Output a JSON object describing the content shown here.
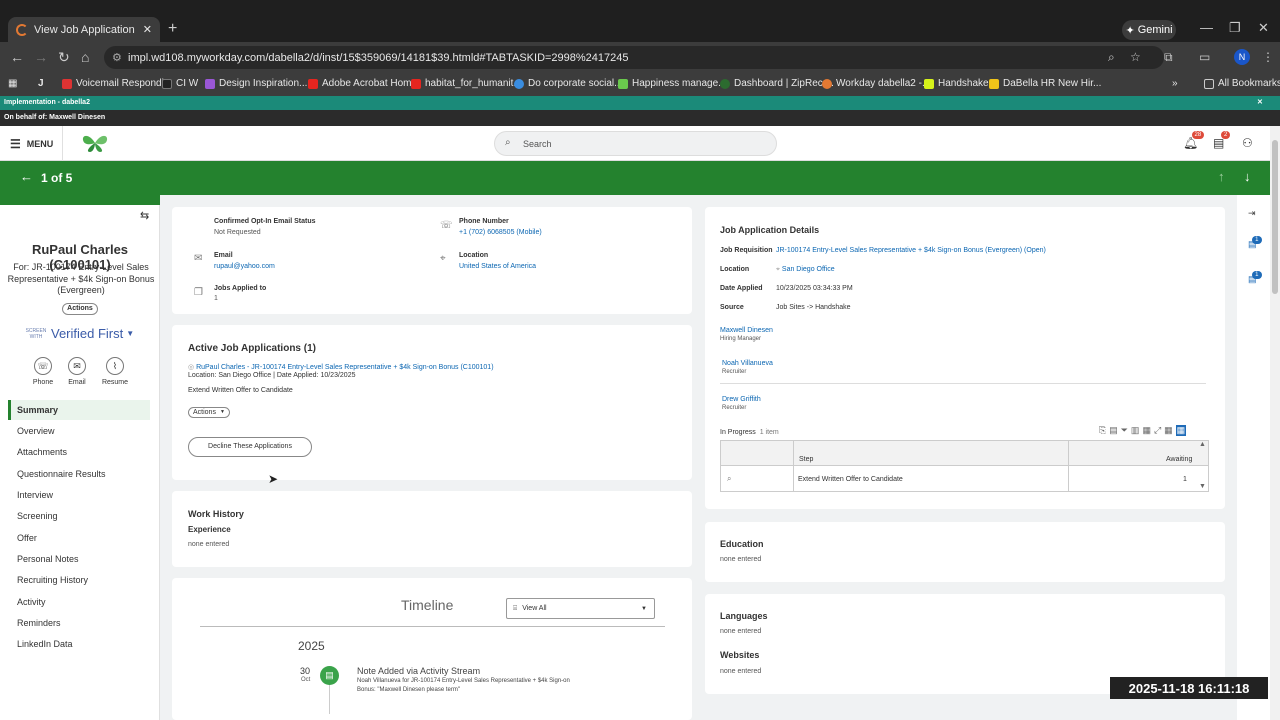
{
  "browser": {
    "tab_title": "View Job Application - RuPaul C",
    "url": "impl.wd108.myworkday.com/dabella2/d/inst/15$359069/14181$39.htmld#TABTASKID=2998%2417245",
    "gemini_label": "Gemini",
    "profile_initial": "N",
    "bookmarks": [
      "Voicemail Respondi...",
      "CI W",
      "Design Inspiration...",
      "Adobe Acrobat Home",
      "habitat_for_humanit...",
      "Do corporate social...",
      "Happiness manage...",
      "Dashboard | ZipRecr...",
      "Workday dabella2 -...",
      "Handshake",
      "DaBella HR New Hir..."
    ],
    "all_bookmarks": "All Bookmarks"
  },
  "impl": {
    "banner": "Implementation - dabella2",
    "behalf": "On behalf of: Maxwell Dinesen"
  },
  "header": {
    "menu_label": "MENU",
    "search_placeholder": "Search",
    "notif_count": "28",
    "inbox_count": "2"
  },
  "pager": "1 of 5",
  "candidate": {
    "name": "RuPaul Charles (C100101)",
    "for": "For: JR-100174 Entry-Level Sales Representative + $4k Sign-on Bonus (Evergreen)",
    "actions_label": "Actions",
    "vf_screen": "SCREEN WITH",
    "vf_brand": "Verified First",
    "quick": [
      "Phone",
      "Email",
      "Resume"
    ]
  },
  "nav": [
    "Summary",
    "Overview",
    "Attachments",
    "Questionnaire Results",
    "Interview",
    "Screening",
    "Offer",
    "Personal Notes",
    "Recruiting History",
    "Activity",
    "Reminders",
    "LinkedIn Data"
  ],
  "contact": {
    "optin_label": "Confirmed Opt-In Email Status",
    "optin_value": "Not Requested",
    "phone_label": "Phone Number",
    "phone_value": "+1 (702) 6068505 (Mobile)",
    "email_label": "Email",
    "email_value": "rupaul@yahoo.com",
    "location_label": "Location",
    "location_value": "United States of America",
    "jobs_label": "Jobs Applied to",
    "jobs_value": "1"
  },
  "active": {
    "title": "Active Job Applications (1)",
    "app_link": "RuPaul Charles - JR-100174 Entry-Level Sales Representative + $4k Sign-on Bonus (C100101)",
    "app_meta": "Location: San Diego Office | Date Applied: 10/23/2025",
    "step": "Extend Written Offer to Candidate",
    "actions": "Actions",
    "decline": "Decline These Applications"
  },
  "work": {
    "title": "Work History",
    "sub": "Experience",
    "value": "none entered"
  },
  "timeline": {
    "title": "Timeline",
    "filter": "View All",
    "year": "2025",
    "day": "30",
    "month": "Oct",
    "event_title": "Note Added via Activity Stream",
    "event_desc": "Noah Villanueva for JR-100174 Entry-Level Sales Representative + $4k Sign-on Bonus: \"Maxwell Dinesen please term\""
  },
  "details": {
    "title": "Job Application Details",
    "req_label": "Job Requisition",
    "req_value": "JR-100174 Entry-Level Sales Representative + $4k Sign-on Bonus (Evergreen) (Open)",
    "loc_label": "Location",
    "loc_value": "San Diego Office",
    "date_label": "Date Applied",
    "date_value": "10/23/2025 03:34:33 PM",
    "source_label": "Source",
    "source_value": "Job Sites -> Handshake",
    "people": [
      {
        "name": "Maxwell Dinesen",
        "role": "Hiring Manager"
      },
      {
        "name": "Noah Villanueva",
        "role": "Recruiter"
      },
      {
        "name": "Drew Griffith",
        "role": "Recruiter"
      }
    ],
    "inprogress": "In Progress",
    "items": "1 item",
    "col_step": "Step",
    "col_awaiting": "Awaiting",
    "row_step": "Extend Written Offer to Candidate",
    "row_awaiting": "1"
  },
  "education": {
    "title": "Education",
    "value": "none entered"
  },
  "languages": {
    "title": "Languages",
    "value": "none entered"
  },
  "websites": {
    "title": "Websites",
    "value": "none entered"
  },
  "rail_badges": [
    "1",
    "1"
  ],
  "timestamp": "2025-11-18  16:11:18"
}
